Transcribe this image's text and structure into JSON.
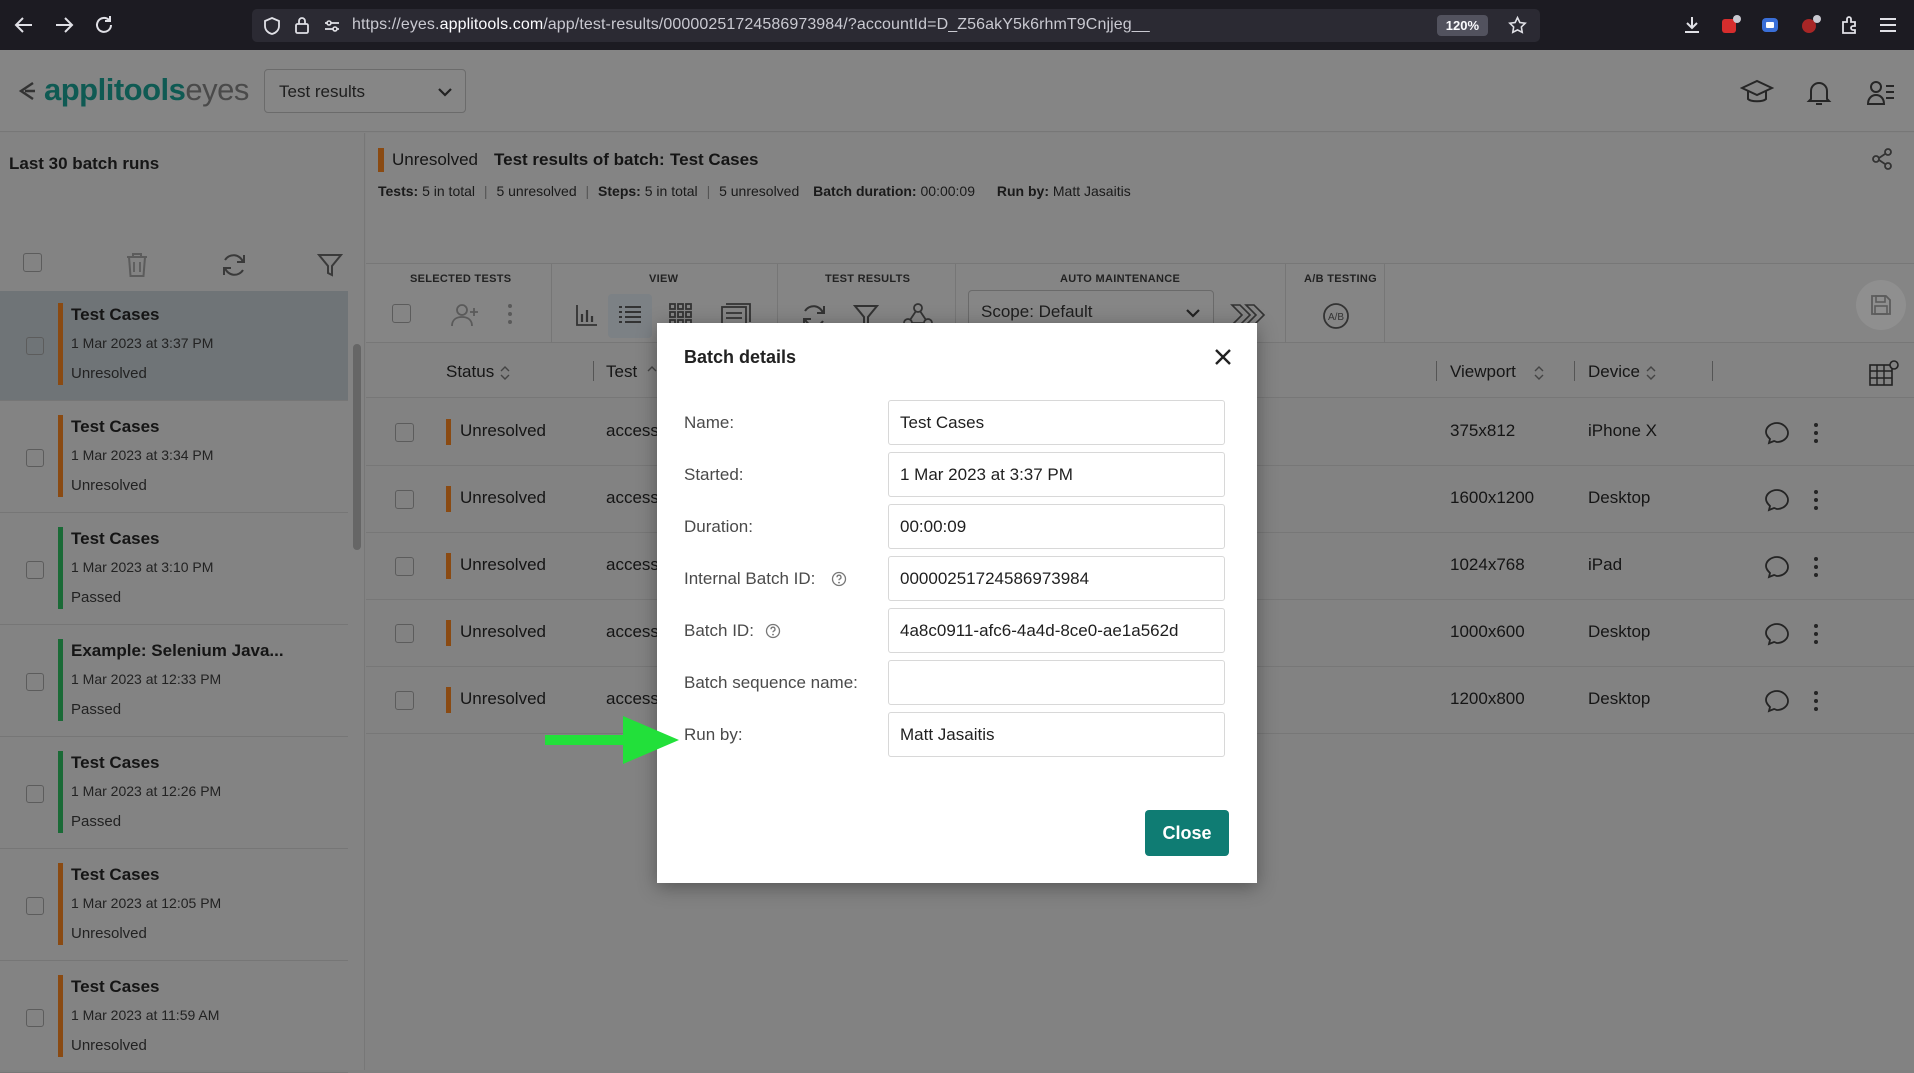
{
  "browser": {
    "url_prefix": "https://eyes.",
    "url_domain": "applitools.com",
    "url_suffix": "/app/test-results/00000251724586973984/?accountId=D_Z56akY5k6rhmT9Cnjjeg__",
    "zoom": "120%"
  },
  "header": {
    "logo_primary": "applitools",
    "logo_secondary": "eyes",
    "view_dropdown": "Test results"
  },
  "left_panel": {
    "title": "Last 30 batch runs",
    "batches": [
      {
        "name": "Test Cases",
        "date": "1 Mar 2023 at 3:37 PM",
        "status": "Unresolved"
      },
      {
        "name": "Test Cases",
        "date": "1 Mar 2023 at 3:34 PM",
        "status": "Unresolved"
      },
      {
        "name": "Test Cases",
        "date": "1 Mar 2023 at 3:10 PM",
        "status": "Passed"
      },
      {
        "name": "Example: Selenium Java...",
        "date": "1 Mar 2023 at 12:33 PM",
        "status": "Passed"
      },
      {
        "name": "Test Cases",
        "date": "1 Mar 2023 at 12:26 PM",
        "status": "Passed"
      },
      {
        "name": "Test Cases",
        "date": "1 Mar 2023 at 12:05 PM",
        "status": "Unresolved"
      },
      {
        "name": "Test Cases",
        "date": "1 Mar 2023 at 11:59 AM",
        "status": "Unresolved"
      }
    ]
  },
  "batch_header": {
    "status": "Unresolved",
    "title_prefix": "Test results of batch:",
    "title_name": "Test Cases",
    "tests_label": "Tests:",
    "tests_total": "5 in total",
    "tests_unresolved": "5 unresolved",
    "steps_label": "Steps:",
    "steps_total": "5 in total",
    "steps_unresolved": "5 unresolved",
    "duration_label": "Batch duration:",
    "duration_value": "00:00:09",
    "runby_label": "Run by:",
    "runby_value": "Matt Jasaitis"
  },
  "toolbar": {
    "selected_tests": "SELECTED TESTS",
    "view": "VIEW",
    "test_results": "TEST RESULTS",
    "auto_maintenance": "AUTO MAINTENANCE",
    "ab_testing": "A/B TESTING",
    "scope": "Scope: Default"
  },
  "grid": {
    "columns": {
      "status": "Status",
      "test": "Test",
      "viewport": "Viewport",
      "device": "Device"
    },
    "rows": [
      {
        "status": "Unresolved",
        "test": "access",
        "viewport": "375x812",
        "device": "iPhone X"
      },
      {
        "status": "Unresolved",
        "test": "access",
        "viewport": "1600x1200",
        "device": "Desktop"
      },
      {
        "status": "Unresolved",
        "test": "access",
        "viewport": "1024x768",
        "device": "iPad"
      },
      {
        "status": "Unresolved",
        "test": "access",
        "viewport": "1000x600",
        "device": "Desktop"
      },
      {
        "status": "Unresolved",
        "test": "access",
        "viewport": "1200x800",
        "device": "Desktop"
      }
    ]
  },
  "modal": {
    "title": "Batch details",
    "fields": [
      {
        "label": "Name:",
        "value": "Test Cases"
      },
      {
        "label": "Started:",
        "value": "1 Mar 2023 at 3:37 PM"
      },
      {
        "label": "Duration:",
        "value": "00:00:09"
      },
      {
        "label": "Internal Batch ID:",
        "value": "00000251724586973984"
      },
      {
        "label": "Batch ID:",
        "value": "4a8c0911-afc6-4a4d-8ce0-ae1a562d"
      },
      {
        "label": "Batch sequence name:",
        "value": ""
      },
      {
        "label": "Run by:",
        "value": "Matt Jasaitis"
      }
    ],
    "close_label": "Close"
  },
  "colors": {
    "accent": "#0f7c73",
    "unresolved": "#c8640f",
    "passed": "#1f8a46",
    "arrow": "#22e03a"
  }
}
